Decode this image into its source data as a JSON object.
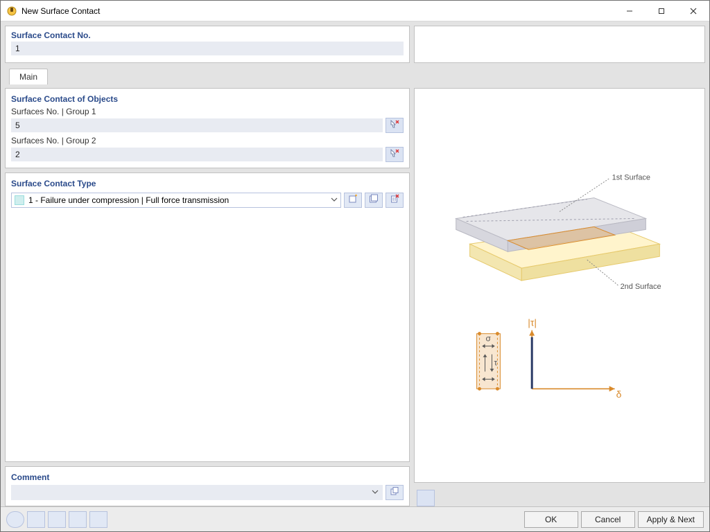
{
  "window": {
    "title": "New Surface Contact"
  },
  "header": {
    "contact_no_label": "Surface Contact No.",
    "contact_no_value": "1"
  },
  "tabs": {
    "main": "Main"
  },
  "objects": {
    "heading": "Surface Contact of Objects",
    "group1_label": "Surfaces No. | Group 1",
    "group1_value": "5",
    "group2_label": "Surfaces No. | Group 2",
    "group2_value": "2"
  },
  "type": {
    "heading": "Surface Contact Type",
    "selected": "1 - Failure under compression | Full force transmission"
  },
  "comment": {
    "heading": "Comment",
    "value": ""
  },
  "preview": {
    "surface1_label": "1st Surface",
    "surface2_label": "2nd Surface",
    "axis_y": "|τ|",
    "axis_x": "δ",
    "sigma": "σ",
    "tau": "τ"
  },
  "buttons": {
    "ok": "OK",
    "cancel": "Cancel",
    "apply_next": "Apply & Next"
  },
  "icons": {
    "pick": "pick-in-view-icon",
    "new": "new-icon",
    "lib": "library-icon",
    "delete": "delete-icon",
    "copy": "copy-icon",
    "zoom": "zoom-icon",
    "units": "units-icon",
    "tree": "tree-icon",
    "display": "display-icon",
    "fx": "function-icon",
    "preview_tool": "show-preview-icon"
  }
}
